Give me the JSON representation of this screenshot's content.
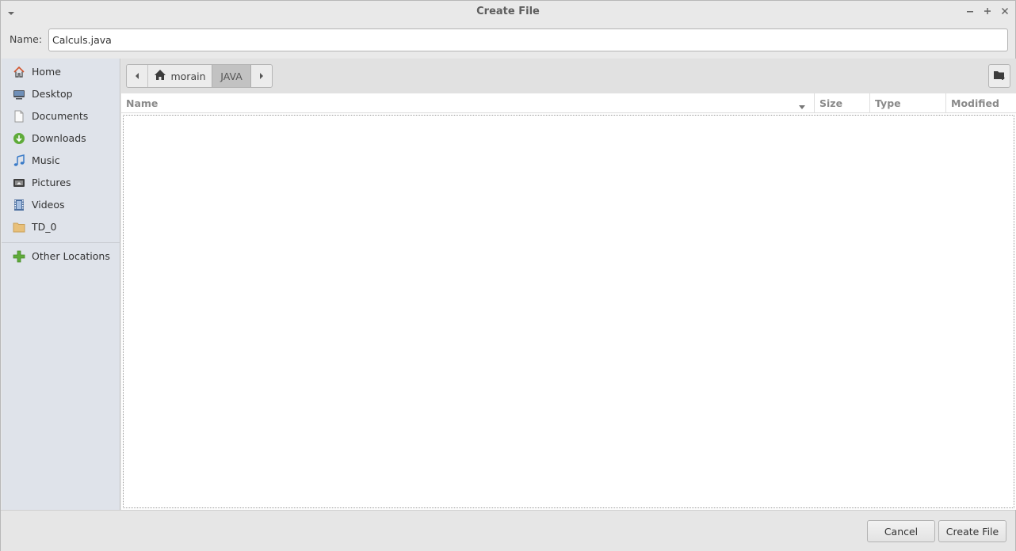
{
  "window": {
    "title": "Create File"
  },
  "name_row": {
    "label": "Name:",
    "value": "Calculs.java"
  },
  "sidebar": {
    "items": [
      {
        "label": "Home",
        "icon": "home-icon"
      },
      {
        "label": "Desktop",
        "icon": "desktop-icon"
      },
      {
        "label": "Documents",
        "icon": "document-icon"
      },
      {
        "label": "Downloads",
        "icon": "download-icon"
      },
      {
        "label": "Music",
        "icon": "music-icon"
      },
      {
        "label": "Pictures",
        "icon": "pictures-icon"
      },
      {
        "label": "Videos",
        "icon": "video-icon"
      },
      {
        "label": "TD_0",
        "icon": "folder-icon"
      }
    ],
    "other": {
      "label": "Other Locations",
      "icon": "plus-icon"
    }
  },
  "pathbar": {
    "home": "morain",
    "current": "JAVA"
  },
  "columns": {
    "name": "Name",
    "size": "Size",
    "type": "Type",
    "modified": "Modified"
  },
  "buttons": {
    "cancel": "Cancel",
    "create": "Create File"
  },
  "colors": {
    "sidebar_bg": "#dfe3ea",
    "active_crumb": "#c2c2c2",
    "home_icon": "#d2552e",
    "downloads_icon": "#5fab3a",
    "music_icon": "#3a7bc8",
    "plus_icon": "#5fab3a"
  }
}
